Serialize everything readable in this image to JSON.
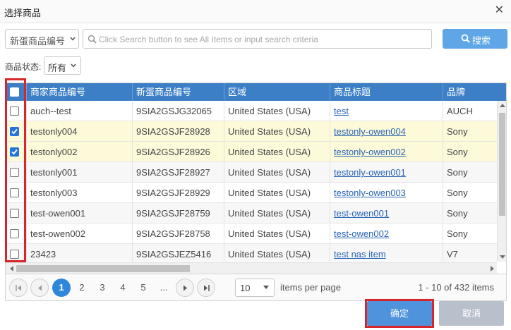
{
  "dialog": {
    "title": "选择商品",
    "close_glyph": "✕"
  },
  "search": {
    "type_value": "新蛋商品编号",
    "placeholder": "Click Search button to see All Items or input search criteria",
    "button_label": "搜索"
  },
  "status_filter": {
    "label": "商品状态:",
    "value": "所有"
  },
  "table": {
    "columns": [
      "商家商品编号",
      "新蛋商品编号",
      "区域",
      "商品标题",
      "品牌"
    ],
    "rows": [
      {
        "checked": false,
        "seller_sku": "auch--test",
        "newegg_item": "9SIA2GSJG32065",
        "region": "United States (USA)",
        "title": "test",
        "brand": "AUCH"
      },
      {
        "checked": true,
        "seller_sku": "testonly004",
        "newegg_item": "9SIA2GSJF28928",
        "region": "United States (USA)",
        "title": "testonly-owen004",
        "brand": "Sony"
      },
      {
        "checked": true,
        "seller_sku": "testonly002",
        "newegg_item": "9SIA2GSJF28926",
        "region": "United States (USA)",
        "title": "testonly-owen002",
        "brand": "Sony"
      },
      {
        "checked": false,
        "seller_sku": "testonly001",
        "newegg_item": "9SIA2GSJF28927",
        "region": "United States (USA)",
        "title": "testonly-owen001",
        "brand": "Sony"
      },
      {
        "checked": false,
        "seller_sku": "testonly003",
        "newegg_item": "9SIA2GSJF28929",
        "region": "United States (USA)",
        "title": "testonly-owen003",
        "brand": "Sony"
      },
      {
        "checked": false,
        "seller_sku": "test-owen001",
        "newegg_item": "9SIA2GSJF28759",
        "region": "United States (USA)",
        "title": "test-owen001",
        "brand": "Sony"
      },
      {
        "checked": false,
        "seller_sku": "test-owen002",
        "newegg_item": "9SIA2GSJF28758",
        "region": "United States (USA)",
        "title": "test-owen002",
        "brand": "Sony"
      },
      {
        "checked": false,
        "seller_sku": "23423",
        "newegg_item": "9SIA2GSJEZ5416",
        "region": "United States (USA)",
        "title": "test nas item",
        "brand": "V7"
      }
    ]
  },
  "pager": {
    "pages": [
      "1",
      "2",
      "3",
      "4",
      "5",
      "..."
    ],
    "current_page": "1",
    "page_size": "10",
    "items_per_page_label": "items per page",
    "info": "1 - 10 of 432 items"
  },
  "actions": {
    "ok_label": "确定",
    "cancel_label": "取消"
  },
  "colors": {
    "header_bg": "#3c7fc6",
    "primary": "#5ea6e6",
    "selected_row": "#fcfad9",
    "highlight": "#d9252a",
    "link": "#2a64b4"
  }
}
